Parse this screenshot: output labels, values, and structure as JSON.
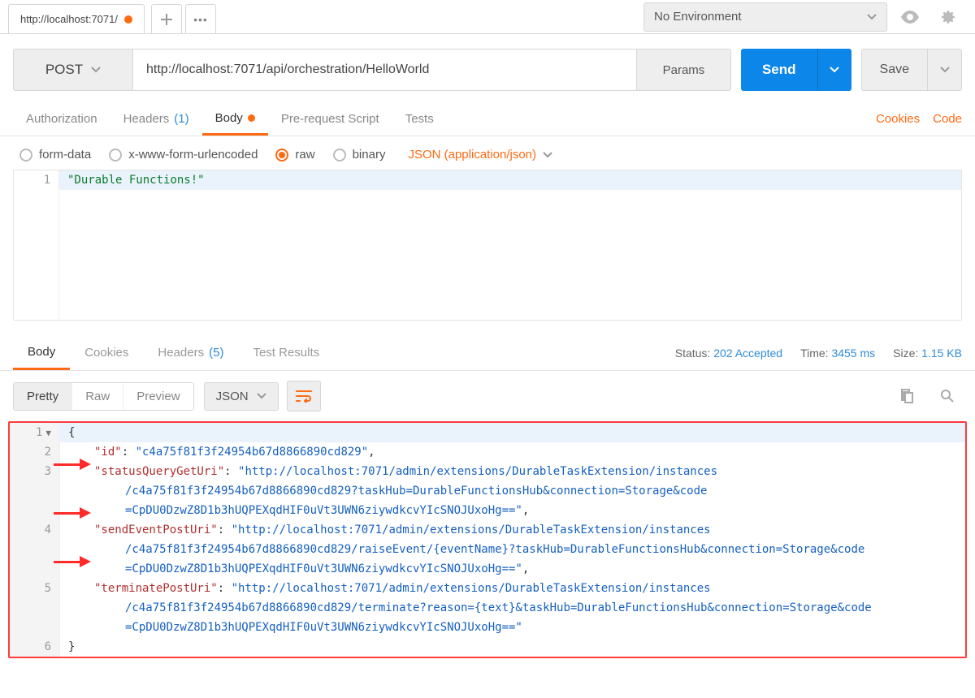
{
  "tab": {
    "title": "http://localhost:7071/"
  },
  "top": {
    "env": "No Environment"
  },
  "request": {
    "method": "POST",
    "url": "http://localhost:7071/api/orchestration/HelloWorld",
    "params_label": "Params",
    "send_label": "Send",
    "save_label": "Save"
  },
  "subtabs": {
    "auth": "Authorization",
    "headers": "Headers",
    "headers_count": "(1)",
    "body": "Body",
    "prereq": "Pre-request Script",
    "tests": "Tests",
    "cookies": "Cookies",
    "code": "Code"
  },
  "bodytype": {
    "formdata": "form-data",
    "urlenc": "x-www-form-urlencoded",
    "raw": "raw",
    "binary": "binary",
    "content_type": "JSON (application/json)"
  },
  "req_body": {
    "line1_num": "1",
    "line1_text": "\"Durable Functions!\""
  },
  "resp_tabs": {
    "body": "Body",
    "cookies": "Cookies",
    "headers": "Headers",
    "headers_count": "(5)",
    "tests": "Test Results"
  },
  "resp_meta": {
    "status_label": "Status:",
    "status_value": "202 Accepted",
    "time_label": "Time:",
    "time_value": "3455 ms",
    "size_label": "Size:",
    "size_value": "1.15 KB"
  },
  "resp_toolbar": {
    "pretty": "Pretty",
    "raw": "Raw",
    "preview": "Preview",
    "fmt": "JSON"
  },
  "resp_body": {
    "l1": "{",
    "l2_key": "\"id\"",
    "l2_val": "\"c4a75f81f3f24954b67d8866890cd829\"",
    "l3_key": "\"statusQueryGetUri\"",
    "l3_val_a": "\"http://localhost:7071/admin/extensions/DurableTaskExtension/instances",
    "l3_val_b": "/c4a75f81f3f24954b67d8866890cd829?taskHub=DurableFunctionsHub&connection=Storage&code",
    "l3_val_c": "=CpDU0DzwZ8D1b3hUQPEXqdHIF0uVt3UWN6ziywdkcvYIcSNOJUxoHg==\"",
    "l4_key": "\"sendEventPostUri\"",
    "l4_val_a": "\"http://localhost:7071/admin/extensions/DurableTaskExtension/instances",
    "l4_val_b": "/c4a75f81f3f24954b67d8866890cd829/raiseEvent/{eventName}?taskHub=DurableFunctionsHub&connection=Storage&code",
    "l4_val_c": "=CpDU0DzwZ8D1b3hUQPEXqdHIF0uVt3UWN6ziywdkcvYIcSNOJUxoHg==\"",
    "l5_key": "\"terminatePostUri\"",
    "l5_val_a": "\"http://localhost:7071/admin/extensions/DurableTaskExtension/instances",
    "l5_val_b": "/c4a75f81f3f24954b67d8866890cd829/terminate?reason={text}&taskHub=DurableFunctionsHub&connection=Storage&code",
    "l5_val_c": "=CpDU0DzwZ8D1b3hUQPEXqdHIF0uVt3UWN6ziywdkcvYIcSNOJUxoHg==\"",
    "l6": "}"
  }
}
